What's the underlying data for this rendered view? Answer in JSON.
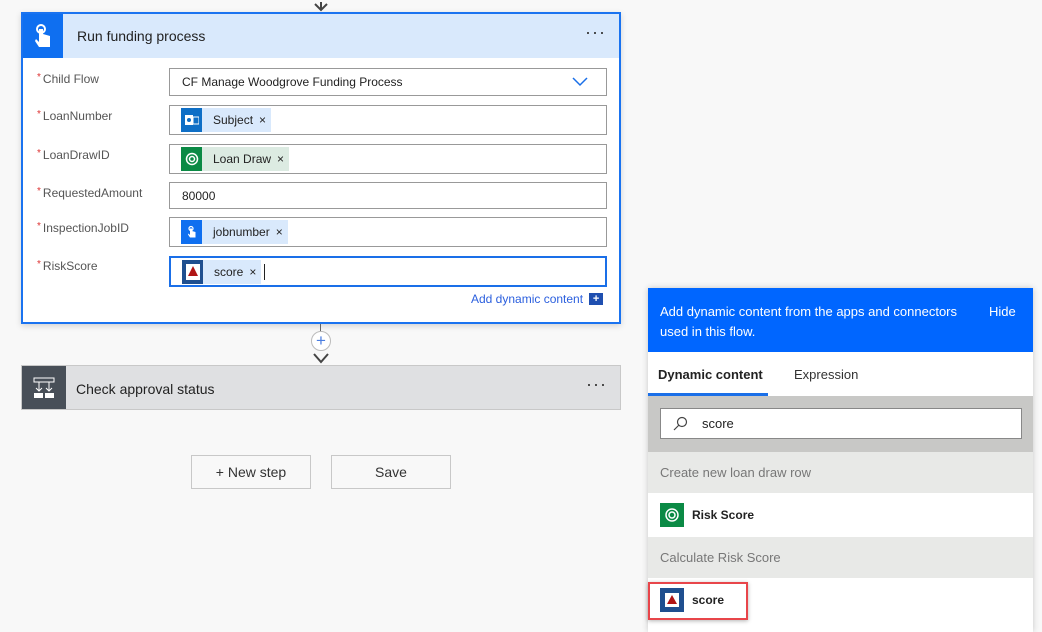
{
  "card": {
    "title": "Run funding process",
    "more": "···",
    "fields": [
      {
        "label": "Child Flow",
        "value": "CF Manage Woodgrove Funding Process"
      },
      {
        "label": "LoanNumber",
        "token": "Subject"
      },
      {
        "label": "LoanDrawID",
        "token": "Loan Draw"
      },
      {
        "label": "RequestedAmount",
        "value": "80000"
      },
      {
        "label": "InspectionJobID",
        "token": "jobnumber"
      },
      {
        "label": "RiskScore",
        "token": "score"
      }
    ],
    "required_mark": "*",
    "remove": "×",
    "add_dynamic": "Add dynamic content",
    "add_dynamic_icon": "+"
  },
  "step2": {
    "title": "Check approval status",
    "more": "···"
  },
  "buttons": {
    "new_step": "+ New step",
    "save": "Save"
  },
  "panel": {
    "header": "Add dynamic content from the apps and connectors used in this flow.",
    "hide": "Hide",
    "tabs": [
      "Dynamic content",
      "Expression"
    ],
    "search_value": "score",
    "sections": [
      {
        "title": "Create new loan draw row",
        "items": [
          "Risk Score"
        ]
      },
      {
        "title": "Calculate Risk Score",
        "items": [
          "score"
        ]
      }
    ]
  },
  "colors": {
    "accent": "#0066ff",
    "dataverse": "#0b8a45",
    "outlook": "#0f6fc6",
    "highlight": "#e8454a"
  }
}
